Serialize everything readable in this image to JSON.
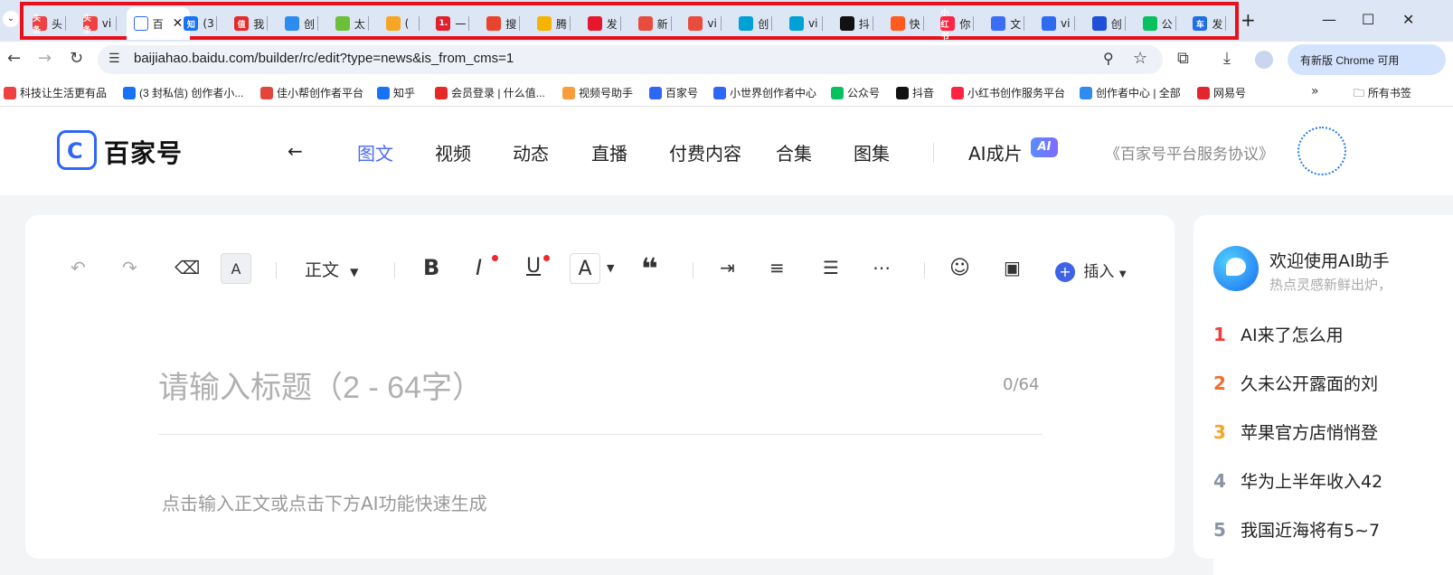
{
  "browser": {
    "tabs": [
      {
        "icon": "toutiao-icon",
        "icon_text": "头条",
        "color": "#f04142",
        "label": "头"
      },
      {
        "icon": "toutiao-icon",
        "icon_text": "头条",
        "color": "#f04142",
        "label": "vi"
      },
      {
        "icon": "baijiahao-icon",
        "icon_text": "",
        "color": "#ffffff",
        "label": "百",
        "active": true
      },
      {
        "icon": "zhihu-icon",
        "icon_text": "知",
        "color": "#1772f6",
        "label": "(3"
      },
      {
        "icon": "smzdm-icon",
        "icon_text": "值",
        "color": "#e62828",
        "label": "我"
      },
      {
        "icon": "creator-icon",
        "icon_text": "",
        "color": "#2e8cf0",
        "label": "创"
      },
      {
        "icon": "leaf-icon",
        "icon_text": "",
        "color": "#6bbf3a",
        "label": "太"
      },
      {
        "icon": "swirl-icon",
        "icon_text": "",
        "color": "#f5a623",
        "label": "("
      },
      {
        "icon": "one-icon",
        "icon_text": "1.",
        "color": "#e0202b",
        "label": "一"
      },
      {
        "icon": "sogou-icon",
        "icon_text": "",
        "color": "#e8432c",
        "label": "搜"
      },
      {
        "icon": "bell-icon",
        "icon_text": "",
        "color": "#f5b400",
        "label": "腾"
      },
      {
        "icon": "weibo-icon",
        "icon_text": "",
        "color": "#e6162d",
        "label": "发"
      },
      {
        "icon": "news-icon",
        "icon_text": "",
        "color": "#e84c3d",
        "label": "新"
      },
      {
        "icon": "news-icon",
        "icon_text": "",
        "color": "#e84c3d",
        "label": "vi"
      },
      {
        "icon": "bilibili-icon",
        "icon_text": "",
        "color": "#00a1d6",
        "label": "创"
      },
      {
        "icon": "bilibili-icon",
        "icon_text": "",
        "color": "#00a1d6",
        "label": "vi"
      },
      {
        "icon": "douyin-icon",
        "icon_text": "",
        "color": "#111111",
        "label": "抖"
      },
      {
        "icon": "kuaishou-icon",
        "icon_text": "",
        "color": "#ff5a1f",
        "label": "快"
      },
      {
        "icon": "xiaohongshu-icon",
        "icon_text": "小红书",
        "color": "#ff2442",
        "label": "你"
      },
      {
        "icon": "wenku-icon",
        "icon_text": "",
        "color": "#3b6ef5",
        "label": "文"
      },
      {
        "icon": "doc-icon",
        "icon_text": "",
        "color": "#2f6bf0",
        "label": "vi"
      },
      {
        "icon": "creator-icon",
        "icon_text": "",
        "color": "#1d4fd8",
        "label": "创"
      },
      {
        "icon": "wechat-icon",
        "icon_text": "",
        "color": "#07c160",
        "label": "公"
      },
      {
        "icon": "car-icon",
        "icon_text": "车",
        "color": "#1f6fe0",
        "label": "发"
      }
    ],
    "url": "baijiahao.baidu.com/builder/rc/edit?type=news&is_from_cms=1",
    "update_label": "有新版 Chrome 可用",
    "bookmarks": [
      {
        "label": "科技让生活更有品",
        "icon": "toutiao-icon",
        "color": "#f04142"
      },
      {
        "label": "(3 封私信) 创作者小...",
        "icon": "zhihu-icon",
        "color": "#1772f6"
      },
      {
        "label": "佳小帮创作者平台",
        "icon": "jia-icon",
        "color": "#e2453b"
      },
      {
        "label": "知乎",
        "icon": "zhihu-icon",
        "color": "#1772f6"
      },
      {
        "label": "会员登录 | 什么值...",
        "icon": "smzdm-icon",
        "color": "#e62828"
      },
      {
        "label": "视频号助手",
        "icon": "channels-icon",
        "color": "#fa9d3b"
      },
      {
        "label": "百家号",
        "icon": "baijiahao-icon",
        "color": "#2e66f5"
      },
      {
        "label": "小世界创作者中心",
        "icon": "play-icon",
        "color": "#2e66f5"
      },
      {
        "label": "公众号",
        "icon": "wechat-icon",
        "color": "#07c160"
      },
      {
        "label": "抖音",
        "icon": "douyin-icon",
        "color": "#111111"
      },
      {
        "label": "小红书创作服务平台",
        "icon": "xiaohongshu-icon",
        "color": "#ff2442"
      },
      {
        "label": "创作者中心 | 全部",
        "icon": "creator-icon",
        "color": "#2e8cf0"
      },
      {
        "label": "网易号",
        "icon": "netease-icon",
        "color": "#e3262b"
      }
    ],
    "all_bookmarks": "所有书签"
  },
  "header": {
    "logo_text": "百家号",
    "nav": [
      "图文",
      "视频",
      "动态",
      "直播",
      "付费内容",
      "合集",
      "图集"
    ],
    "ai_label": "AI成片",
    "ai_badge": "AI",
    "agreement": "《百家号平台服务协议》"
  },
  "toolbar": {
    "paragraph_style": "正文",
    "insert_label": "插入"
  },
  "editor": {
    "title_placeholder": "请输入标题（2 - 64字）",
    "title_counter": "0/64",
    "body_placeholder": "点击输入正文或点击下方AI功能快速生成"
  },
  "ai_panel": {
    "title": "欢迎使用AI助手",
    "subtitle": "热点灵感新鲜出炉，",
    "hot_list": [
      {
        "rank": "1",
        "text": "AI来了怎么用",
        "color": "#f23b3b"
      },
      {
        "rank": "2",
        "text": "久未公开露面的刘",
        "color": "#f26c2b"
      },
      {
        "rank": "3",
        "text": "苹果官方店悄悄登",
        "color": "#f5a623"
      },
      {
        "rank": "4",
        "text": "华为上半年收入42",
        "color": "#8a94a6"
      },
      {
        "rank": "5",
        "text": "我国近海将有5~7",
        "color": "#8a94a6"
      }
    ]
  }
}
